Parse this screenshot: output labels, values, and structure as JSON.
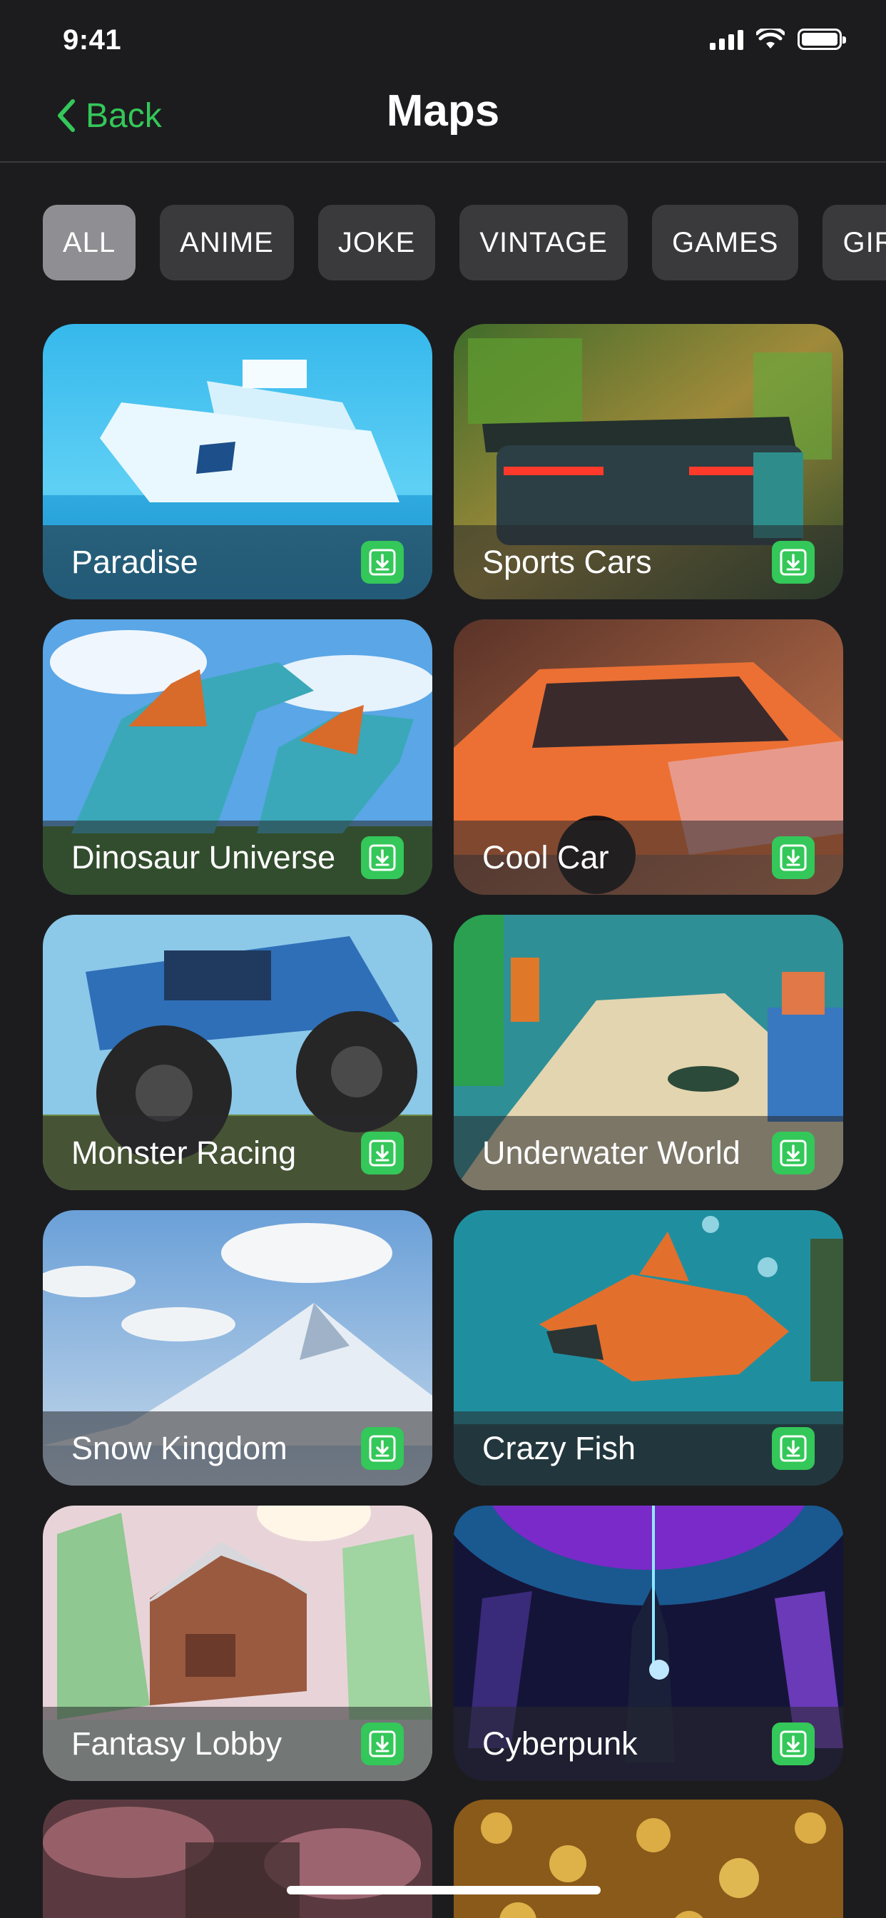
{
  "status_bar": {
    "time": "9:41"
  },
  "nav": {
    "back_label": "Back",
    "title": "Maps"
  },
  "filters": [
    {
      "label": "ALL",
      "active": true
    },
    {
      "label": "ANIME",
      "active": false
    },
    {
      "label": "JOKE",
      "active": false
    },
    {
      "label": "VINTAGE",
      "active": false
    },
    {
      "label": "GAMES",
      "active": false
    },
    {
      "label": "GIRLS",
      "active": false
    }
  ],
  "maps": [
    {
      "title": "Paradise",
      "icon": "download-icon"
    },
    {
      "title": "Sports Cars",
      "icon": "download-icon"
    },
    {
      "title": "Dinosaur Universe",
      "icon": "download-icon"
    },
    {
      "title": "Cool Car",
      "icon": "download-icon"
    },
    {
      "title": "Monster Racing",
      "icon": "download-icon"
    },
    {
      "title": "Underwater World",
      "icon": "download-icon"
    },
    {
      "title": "Snow Kingdom",
      "icon": "download-icon"
    },
    {
      "title": "Crazy Fish",
      "icon": "download-icon"
    },
    {
      "title": "Fantasy Lobby",
      "icon": "download-icon"
    },
    {
      "title": "Cyberpunk",
      "icon": "download-icon"
    }
  ],
  "colors": {
    "accent": "#34c759",
    "background": "#1c1c1e",
    "chip": "#3a3a3c",
    "chip_active": "#8e8e93"
  }
}
